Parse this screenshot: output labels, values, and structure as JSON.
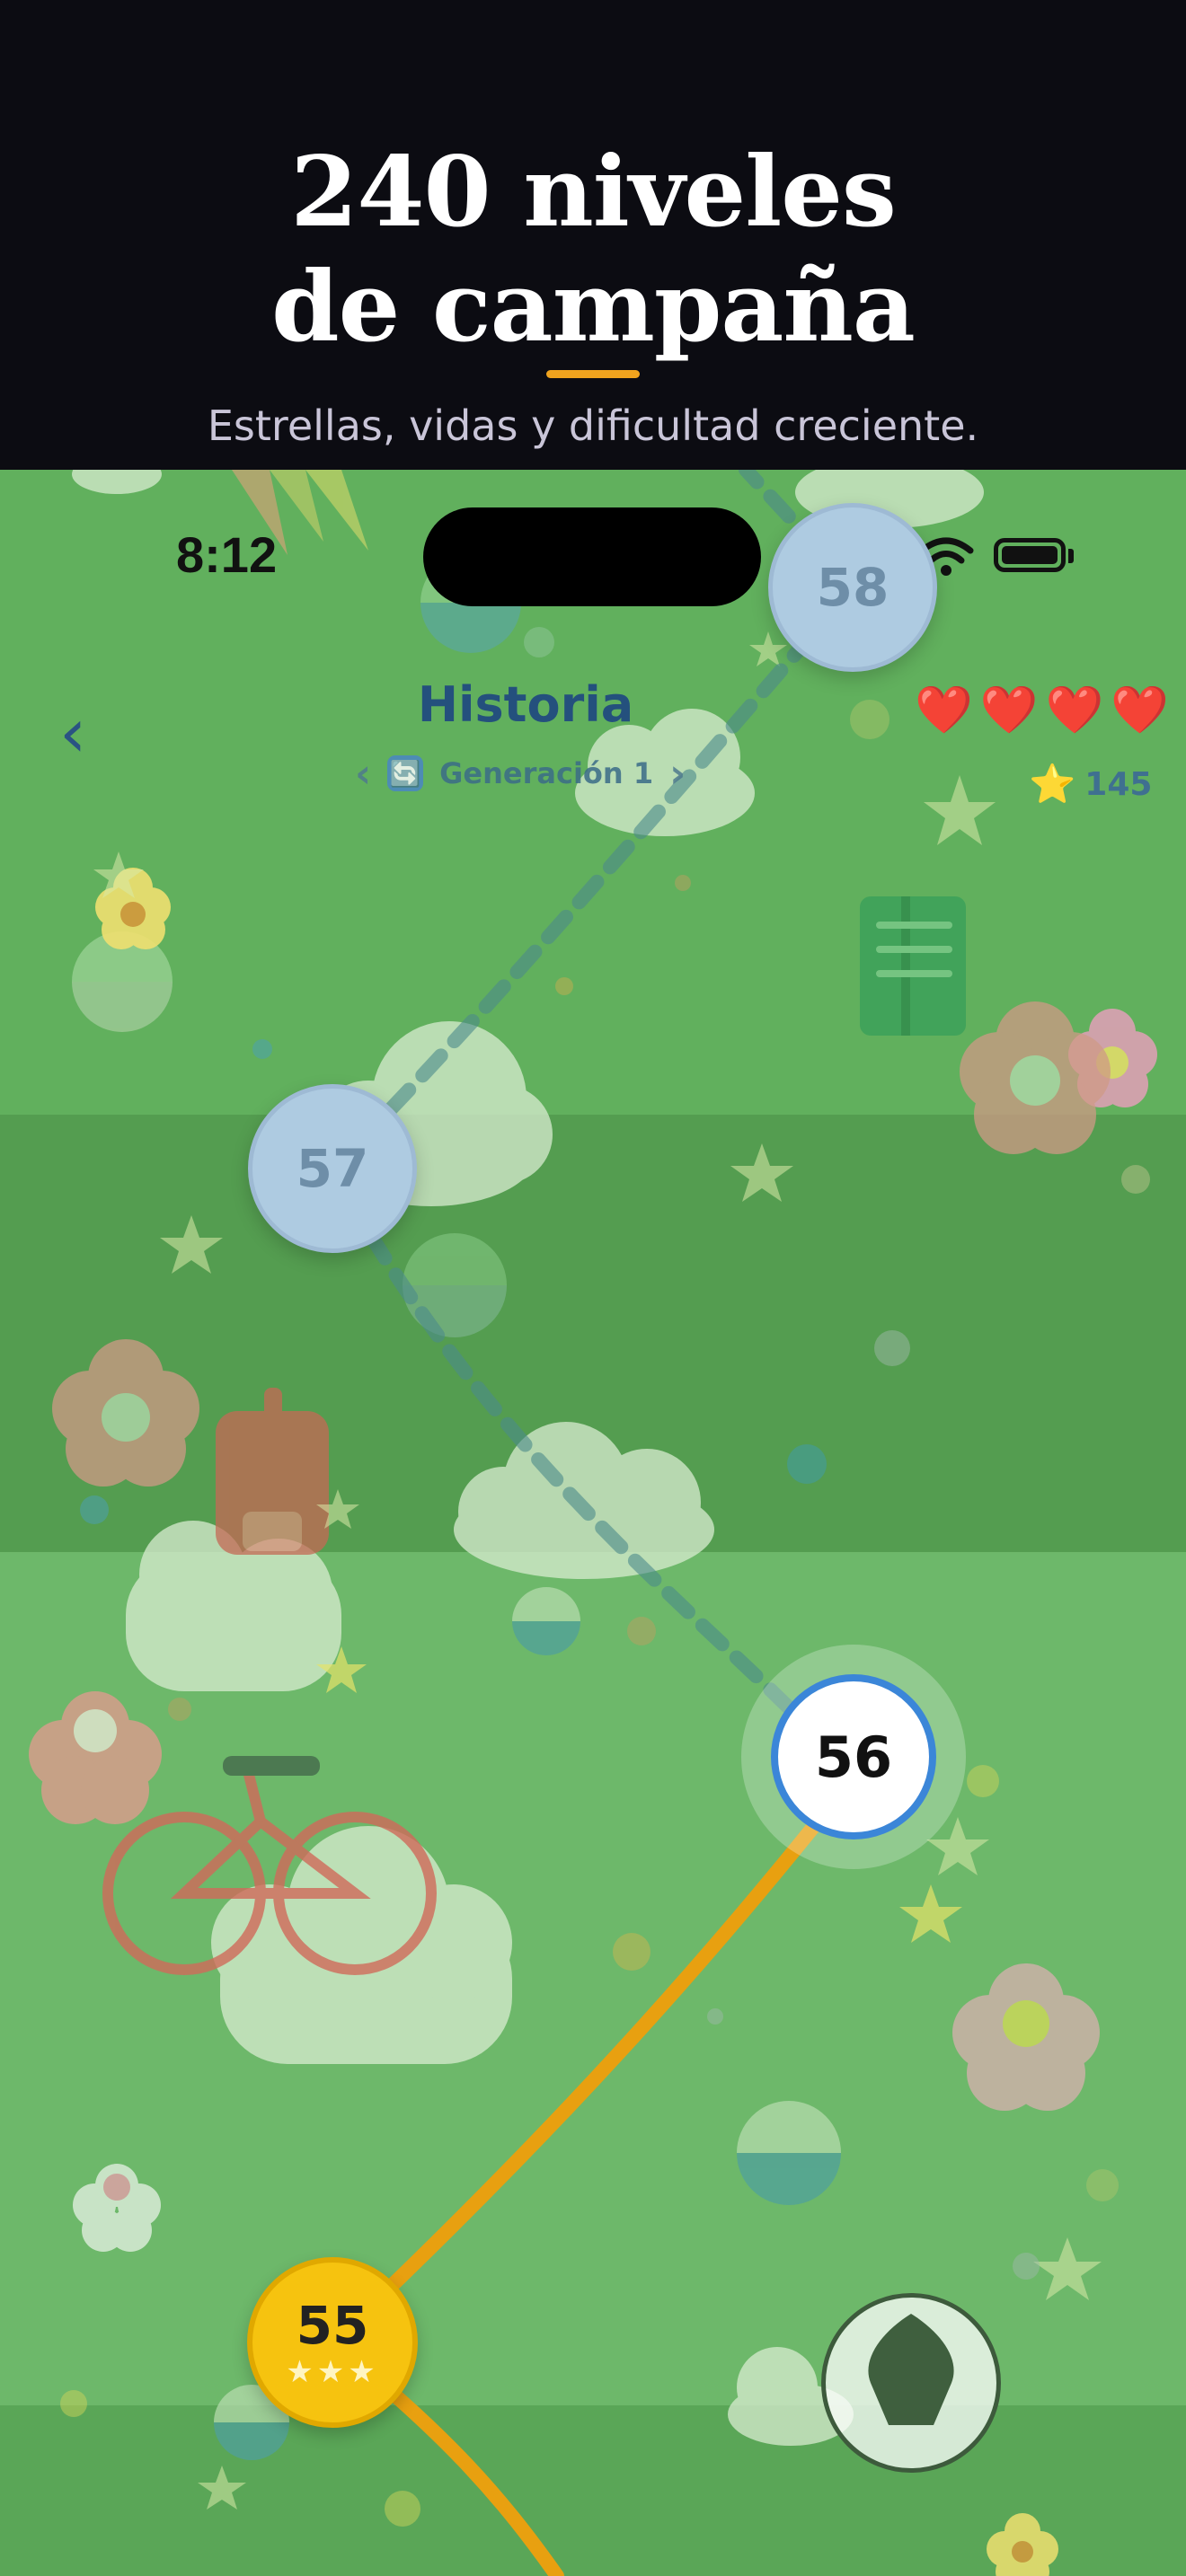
{
  "promo": {
    "title_line1": "240 niveles",
    "title_line2": "de campaña",
    "subtitle": "Estrellas, vidas y dificultad creciente."
  },
  "status_bar": {
    "time": "8:12"
  },
  "header": {
    "back_icon": "‹",
    "title": "Historia",
    "generation_label": "Generación 1",
    "generation_prev": "‹",
    "generation_next": "›",
    "generation_icon": "🔄",
    "hearts": [
      "❤️",
      "❤️",
      "❤️",
      "❤️"
    ],
    "star_icon": "⭐",
    "stars_total": "145"
  },
  "levels": [
    {
      "number": "58",
      "state": "locked"
    },
    {
      "number": "57",
      "state": "locked"
    },
    {
      "number": "56",
      "state": "current"
    },
    {
      "number": "55",
      "state": "completed",
      "stars": "★★★"
    }
  ],
  "colors": {
    "promo_bg": "#0c0c12",
    "accent_underline": "#f0a31e",
    "map_green": "#5fae5b",
    "locked_node": "#aecbe1",
    "current_ring": "#3b86d8",
    "completed_node": "#f6c30f",
    "path_completed": "#e8a010",
    "path_locked": "#4b8a8a",
    "title_blue": "#24507d"
  },
  "icons": {
    "fab": "leaf-icon",
    "signal": "wifi-icon",
    "battery": "battery-icon"
  }
}
